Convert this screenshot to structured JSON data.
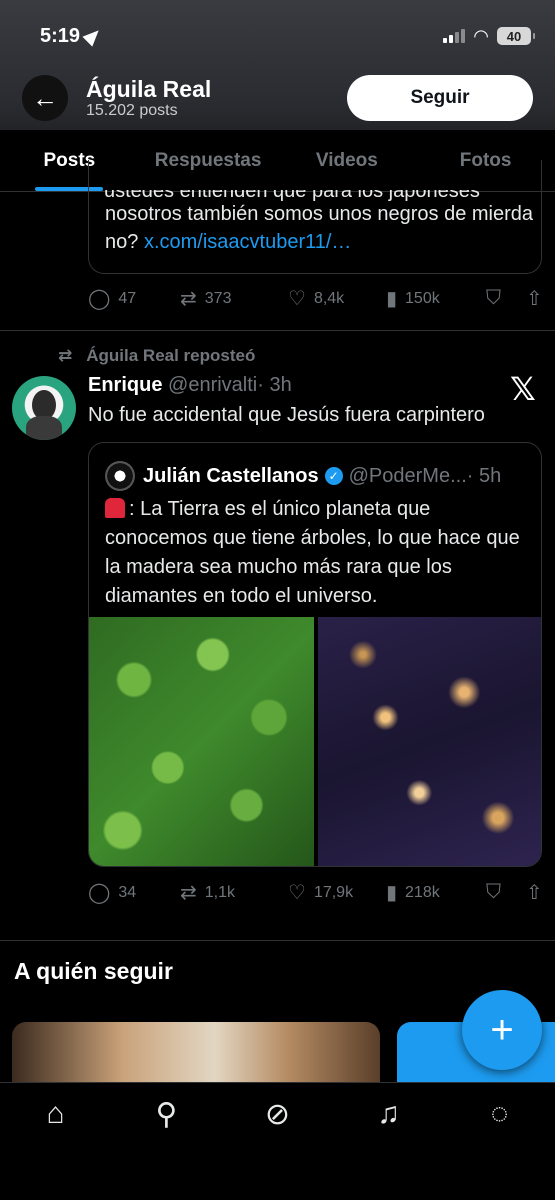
{
  "status_bar": {
    "time": "5:19",
    "battery": "40"
  },
  "header": {
    "name": "Águila Real",
    "posts": "15.202 posts",
    "follow_label": "Seguir"
  },
  "tabs": [
    {
      "label": "Posts",
      "active": true
    },
    {
      "label": "Respuestas"
    },
    {
      "label": "Videos"
    },
    {
      "label": "Fotos"
    }
  ],
  "tweet1": {
    "cut_text": "ustedes entienden que para los japoneses",
    "quote_text": "nosotros también somos unos negros de mierda no?",
    "link": "x.com/isaacvtuber11/…",
    "replies": "47",
    "reposts": "373",
    "likes": "8,4k",
    "views": "150k"
  },
  "tweet2": {
    "repost_label": "Águila Real reposteó",
    "name": "Enrique",
    "handle": "@enrivalti",
    "time": "· 3h",
    "text": "No fue accidental que Jesús fuera carpintero",
    "quote": {
      "name": "Julián Castellanos",
      "handle": "@PoderMe...",
      "time": "· 5h",
      "text": ": La Tierra es el único planeta que conocemos que tiene árboles, lo que hace que la madera sea mucho más rara que los diamantes en todo el universo."
    },
    "replies": "34",
    "reposts": "1,1k",
    "likes": "17,9k",
    "views": "218k"
  },
  "who_to_follow": {
    "title": "A quién seguir"
  },
  "fab_label": "+",
  "icons": {
    "back": "arrow-left-icon",
    "reply": "reply-icon",
    "repost": "repost-icon",
    "like": "heart-icon",
    "views": "views-icon",
    "bookmark": "bookmark-icon",
    "share": "share-icon",
    "home": "home-icon",
    "search": "search-icon",
    "grok": "grok-icon",
    "notifications": "bell-icon",
    "messages": "message-icon"
  },
  "colors": {
    "accent": "#1d9bf0",
    "background": "#000000",
    "muted": "#71767b"
  }
}
